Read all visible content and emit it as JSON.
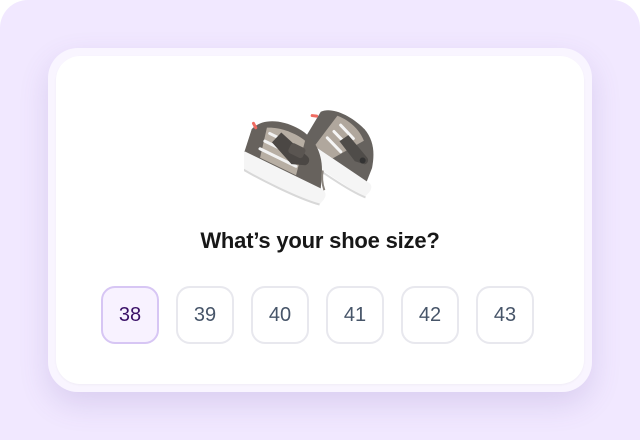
{
  "prompt": {
    "question": "What’s your shoe size?"
  },
  "sizes": [
    {
      "label": "38",
      "selected": true
    },
    {
      "label": "39",
      "selected": false
    },
    {
      "label": "40",
      "selected": false
    },
    {
      "label": "41",
      "selected": false
    },
    {
      "label": "42",
      "selected": false
    },
    {
      "label": "43",
      "selected": false
    }
  ],
  "colors": {
    "backdrop": "#f1e8ff",
    "selected_background": "#f8f2ff",
    "selected_border": "#d7c6f4",
    "selected_text": "#3b1168",
    "unselected_border": "#e8e8ee",
    "unselected_text": "#475569"
  },
  "image": {
    "icon": "sneakers-pair-illustration"
  }
}
